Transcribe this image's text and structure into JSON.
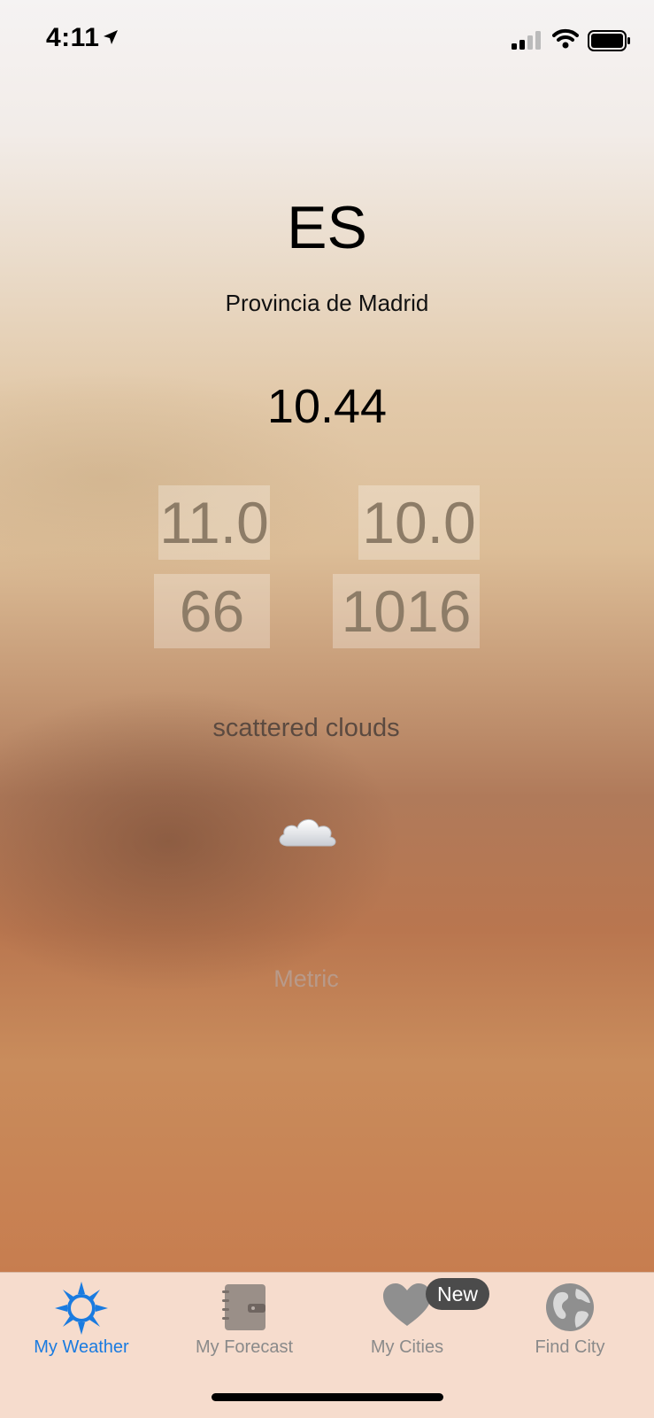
{
  "status_bar": {
    "time": "4:11",
    "icons": [
      "location-arrow-icon",
      "cellular-signal-icon",
      "wifi-icon",
      "battery-icon"
    ]
  },
  "weather": {
    "country": "ES",
    "region": "Provincia de Madrid",
    "temperature": "10.44",
    "max_temp": "11.0",
    "min_temp": "10.0",
    "humidity": "66",
    "pressure": "1016",
    "description": "scattered clouds",
    "condition_icon": "cloud-icon",
    "units_toggle": "Metric"
  },
  "tab_bar": {
    "tabs": [
      {
        "label": "My Weather",
        "icon": "sun-icon",
        "active": true
      },
      {
        "label": "My Forecast",
        "icon": "notebook-icon",
        "active": false
      },
      {
        "label": "My Cities",
        "icon": "heart-icon",
        "active": false,
        "badge": "New"
      },
      {
        "label": "Find City",
        "icon": "globe-icon",
        "active": false
      }
    ]
  },
  "colors": {
    "active_tab": "#1a7be0",
    "inactive_tab": "#8a8a8a",
    "tab_bar_bg": "#f6dccd",
    "badge_bg": "#4b4b4b"
  }
}
